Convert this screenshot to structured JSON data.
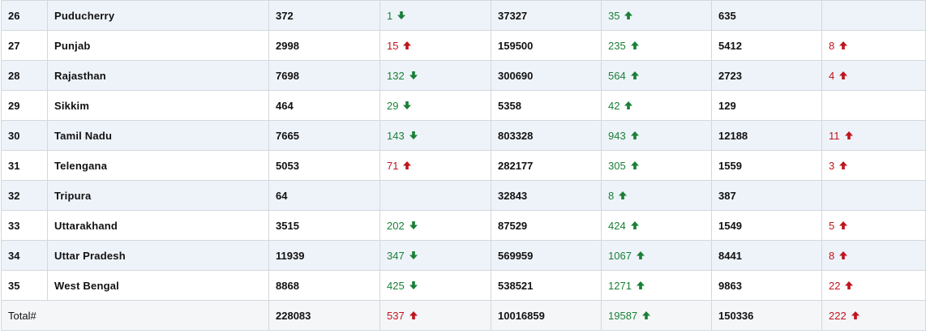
{
  "table": {
    "rows": [
      {
        "sn": "26",
        "state": "Puducherry",
        "active": "372",
        "active_delta": {
          "value": "1",
          "dir": "down"
        },
        "cured": "37327",
        "cured_delta": {
          "value": "35",
          "dir": "up"
        },
        "deaths": "635",
        "deaths_delta": null
      },
      {
        "sn": "27",
        "state": "Punjab",
        "active": "2998",
        "active_delta": {
          "value": "15",
          "dir": "up"
        },
        "cured": "159500",
        "cured_delta": {
          "value": "235",
          "dir": "up"
        },
        "deaths": "5412",
        "deaths_delta": {
          "value": "8",
          "dir": "up"
        }
      },
      {
        "sn": "28",
        "state": "Rajasthan",
        "active": "7698",
        "active_delta": {
          "value": "132",
          "dir": "down"
        },
        "cured": "300690",
        "cured_delta": {
          "value": "564",
          "dir": "up"
        },
        "deaths": "2723",
        "deaths_delta": {
          "value": "4",
          "dir": "up"
        }
      },
      {
        "sn": "29",
        "state": "Sikkim",
        "active": "464",
        "active_delta": {
          "value": "29",
          "dir": "down"
        },
        "cured": "5358",
        "cured_delta": {
          "value": "42",
          "dir": "up"
        },
        "deaths": "129",
        "deaths_delta": null
      },
      {
        "sn": "30",
        "state": "Tamil Nadu",
        "active": "7665",
        "active_delta": {
          "value": "143",
          "dir": "down"
        },
        "cured": "803328",
        "cured_delta": {
          "value": "943",
          "dir": "up"
        },
        "deaths": "12188",
        "deaths_delta": {
          "value": "11",
          "dir": "up"
        }
      },
      {
        "sn": "31",
        "state": "Telengana",
        "active": "5053",
        "active_delta": {
          "value": "71",
          "dir": "up"
        },
        "cured": "282177",
        "cured_delta": {
          "value": "305",
          "dir": "up"
        },
        "deaths": "1559",
        "deaths_delta": {
          "value": "3",
          "dir": "up"
        }
      },
      {
        "sn": "32",
        "state": "Tripura",
        "active": "64",
        "active_delta": null,
        "cured": "32843",
        "cured_delta": {
          "value": "8",
          "dir": "up"
        },
        "deaths": "387",
        "deaths_delta": null
      },
      {
        "sn": "33",
        "state": "Uttarakhand",
        "active": "3515",
        "active_delta": {
          "value": "202",
          "dir": "down"
        },
        "cured": "87529",
        "cured_delta": {
          "value": "424",
          "dir": "up"
        },
        "deaths": "1549",
        "deaths_delta": {
          "value": "5",
          "dir": "up"
        }
      },
      {
        "sn": "34",
        "state": "Uttar Pradesh",
        "active": "11939",
        "active_delta": {
          "value": "347",
          "dir": "down"
        },
        "cured": "569959",
        "cured_delta": {
          "value": "1067",
          "dir": "up"
        },
        "deaths": "8441",
        "deaths_delta": {
          "value": "8",
          "dir": "up"
        }
      },
      {
        "sn": "35",
        "state": "West Bengal",
        "active": "8868",
        "active_delta": {
          "value": "425",
          "dir": "down"
        },
        "cured": "538521",
        "cured_delta": {
          "value": "1271",
          "dir": "up"
        },
        "deaths": "9863",
        "deaths_delta": {
          "value": "22",
          "dir": "up"
        }
      }
    ],
    "total": {
      "label": "Total#",
      "active": "228083",
      "active_delta": {
        "value": "537",
        "dir": "up"
      },
      "cured": "10016859",
      "cured_delta": {
        "value": "19587",
        "dir": "up"
      },
      "deaths": "150336",
      "deaths_delta": {
        "value": "222",
        "dir": "up"
      }
    }
  },
  "colors": {
    "decrease_green": "#1a7f37",
    "increase_red": "#c0151d",
    "cured_increase_green": "#1a7f37",
    "alt_row_bg": "#eef3f9",
    "border": "#d3d8de"
  },
  "icons": {
    "up": "arrow-up-icon",
    "down": "arrow-down-icon"
  }
}
